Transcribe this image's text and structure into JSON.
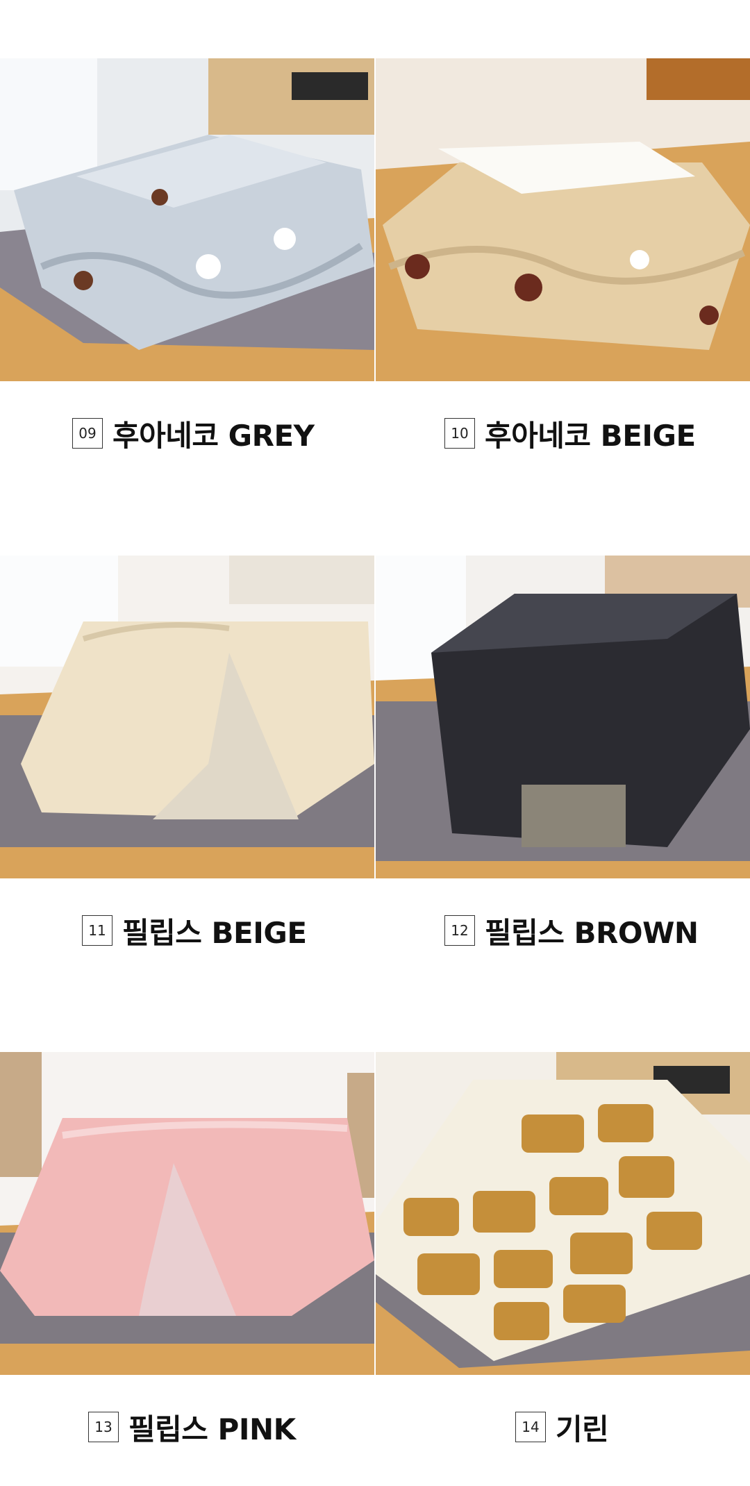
{
  "products": [
    {
      "number": "09",
      "name": "후아네코 GREY",
      "image": "grey cat-print kotatsu futon"
    },
    {
      "number": "10",
      "name": "후아네코 BEIGE",
      "image": "beige cat-print kotatsu futon"
    },
    {
      "number": "11",
      "name": "필립스 BEIGE",
      "image": "beige fur kotatsu futon"
    },
    {
      "number": "12",
      "name": "필립스 BROWN",
      "image": "dark brown fur kotatsu futon"
    },
    {
      "number": "13",
      "name": "필립스 PINK",
      "image": "pink fur kotatsu futon"
    },
    {
      "number": "14",
      "name": "기린",
      "image": "giraffe-pattern kotatsu futon"
    }
  ],
  "colors": {
    "floor_wood": "#d9a35a",
    "rug_grey": "#7f7a82",
    "grey_futon": "#c9d2dc",
    "beige_futon": "#e6cfa6",
    "fur_beige": "#efe2c8",
    "fur_brown": "#2b2b31",
    "fur_pink": "#f2b9b8",
    "giraffe_base": "#f4efe1",
    "giraffe_patch": "#c58f3a"
  }
}
